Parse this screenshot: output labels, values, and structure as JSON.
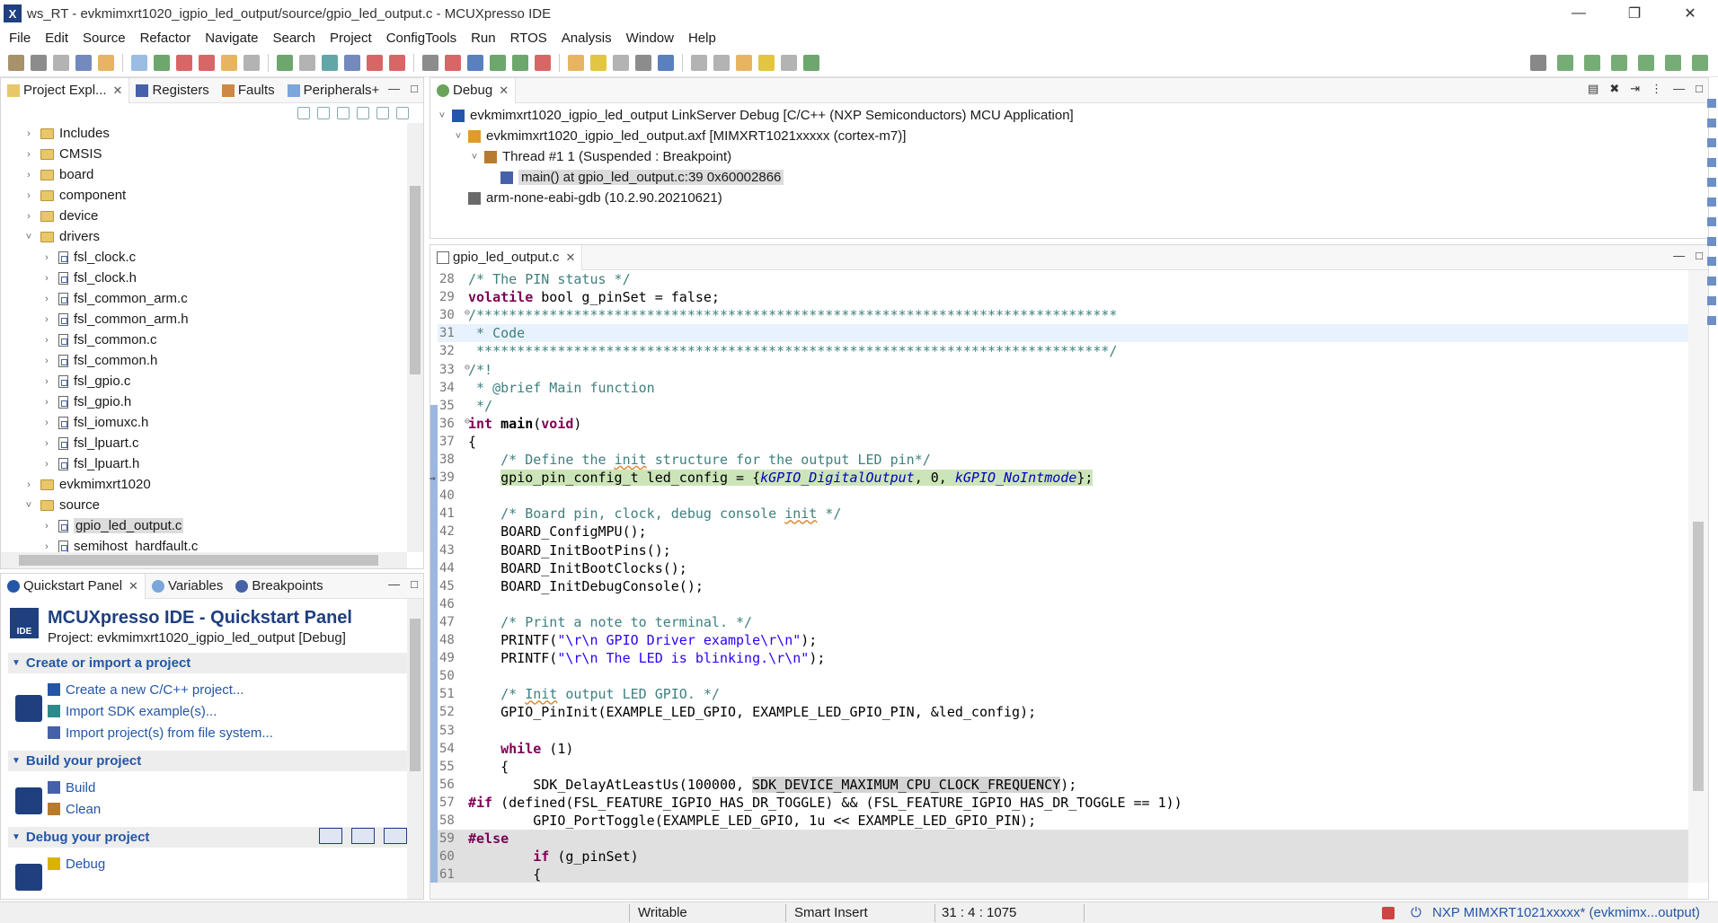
{
  "window": {
    "title": "ws_RT - evkmimxrt1020_igpio_led_output/source/gpio_led_output.c - MCUXpresso IDE",
    "logo_text": "X"
  },
  "menu": [
    "File",
    "Edit",
    "Source",
    "Refactor",
    "Navigate",
    "Search",
    "Project",
    "ConfigTools",
    "Run",
    "RTOS",
    "Analysis",
    "Window",
    "Help"
  ],
  "project_panel": {
    "tabs": [
      {
        "label": "Project Expl...",
        "icon": "project-explorer-icon"
      },
      {
        "label": "Registers",
        "icon": "registers-icon"
      },
      {
        "label": "Faults",
        "icon": "faults-icon"
      },
      {
        "label": "Peripherals+",
        "icon": "peripherals-icon"
      }
    ],
    "tree": [
      {
        "label": "Includes",
        "type": "folder",
        "depth": 1,
        "expanded": false
      },
      {
        "label": "CMSIS",
        "type": "folder",
        "depth": 1,
        "expanded": false
      },
      {
        "label": "board",
        "type": "folder",
        "depth": 1,
        "expanded": false
      },
      {
        "label": "component",
        "type": "folder",
        "depth": 1,
        "expanded": false
      },
      {
        "label": "device",
        "type": "folder",
        "depth": 1,
        "expanded": false
      },
      {
        "label": "drivers",
        "type": "folder",
        "depth": 1,
        "expanded": true
      },
      {
        "label": "fsl_clock.c",
        "type": "file",
        "depth": 2
      },
      {
        "label": "fsl_clock.h",
        "type": "file",
        "depth": 2
      },
      {
        "label": "fsl_common_arm.c",
        "type": "file",
        "depth": 2
      },
      {
        "label": "fsl_common_arm.h",
        "type": "file",
        "depth": 2
      },
      {
        "label": "fsl_common.c",
        "type": "file",
        "depth": 2
      },
      {
        "label": "fsl_common.h",
        "type": "file",
        "depth": 2
      },
      {
        "label": "fsl_gpio.c",
        "type": "file",
        "depth": 2
      },
      {
        "label": "fsl_gpio.h",
        "type": "file",
        "depth": 2
      },
      {
        "label": "fsl_iomuxc.h",
        "type": "file",
        "depth": 2
      },
      {
        "label": "fsl_lpuart.c",
        "type": "file",
        "depth": 2
      },
      {
        "label": "fsl_lpuart.h",
        "type": "file",
        "depth": 2
      },
      {
        "label": "evkmimxrt1020",
        "type": "folder",
        "depth": 1,
        "expanded": false
      },
      {
        "label": "source",
        "type": "folder",
        "depth": 1,
        "expanded": true
      },
      {
        "label": "gpio_led_output.c",
        "type": "file",
        "depth": 2,
        "selected": true
      },
      {
        "label": "semihost_hardfault.c",
        "type": "file",
        "depth": 2
      }
    ]
  },
  "quickstart_panel": {
    "tabs": [
      {
        "label": "Quickstart Panel",
        "icon": "quickstart-icon"
      },
      {
        "label": "Variables",
        "icon": "variables-icon"
      },
      {
        "label": "Breakpoints",
        "icon": "breakpoints-icon"
      }
    ],
    "title": "MCUXpresso IDE - Quickstart Panel",
    "project_line": "Project: evkmimxrt1020_igpio_led_output [Debug]",
    "logo_text": "IDE",
    "sections": [
      {
        "title": "Create or import a project",
        "links": [
          "Create a new C/C++ project...",
          "Import SDK example(s)...",
          "Import project(s) from file system..."
        ]
      },
      {
        "title": "Build your project",
        "links": [
          "Build",
          "Clean"
        ]
      },
      {
        "title": "Debug your project",
        "links": [
          "Debug"
        ]
      }
    ]
  },
  "debug_panel": {
    "tab": "Debug",
    "rows": [
      {
        "label": "evkmimxrt1020_igpio_led_output LinkServer Debug [C/C++ (NXP Semiconductors) MCU Application]",
        "depth": 0
      },
      {
        "label": "evkmimxrt1020_igpio_led_output.axf [MIMXRT1021xxxxx (cortex-m7)]",
        "depth": 1
      },
      {
        "label": "Thread #1 1 (Suspended : Breakpoint)",
        "depth": 2
      },
      {
        "label": "main() at gpio_led_output.c:39 0x60002866",
        "depth": 3,
        "selected": true
      },
      {
        "label": "arm-none-eabi-gdb (10.2.90.20210621)",
        "depth": 1
      }
    ]
  },
  "editor": {
    "tab": "gpio_led_output.c",
    "lines": [
      {
        "n": "28",
        "html": "<span class=\"c\">/* The PIN status */</span>"
      },
      {
        "n": "29",
        "html": "<span class=\"k\">volatile</span> bool g_pinSet = false;"
      },
      {
        "n": "30",
        "fold": true,
        "html": "<span class=\"c\">/*******************************************************************************</span>"
      },
      {
        "n": "31",
        "cur": true,
        "html": "<span class=\"c\"> * Code</span>"
      },
      {
        "n": "32",
        "html": "<span class=\"c\"> ******************************************************************************/</span>"
      },
      {
        "n": "33",
        "fold": true,
        "html": "<span class=\"c\">/*!</span>"
      },
      {
        "n": "34",
        "html": "<span class=\"c\"> * @brief Main function</span>"
      },
      {
        "n": "35",
        "html": "<span class=\"c\"> */</span>"
      },
      {
        "n": "36",
        "fold": true,
        "html": "<span class=\"k\">int</span> <span class=\"f\">main</span>(<span class=\"k\">void</span>)"
      },
      {
        "n": "37",
        "html": "{"
      },
      {
        "n": "38",
        "html": "    <span class=\"c\">/* Define the <span class=\"sq\">init</span> structure for the output LED pin*/</span>"
      },
      {
        "n": "39",
        "exec": true,
        "html": "    <span class=\"hl-exec\">gpio_pin_config_t led_config = {<span class=\"i\">kGPIO_DigitalOutput</span>, 0, <span class=\"i\">kGPIO_NoIntmode</span>};</span>"
      },
      {
        "n": "40",
        "html": ""
      },
      {
        "n": "41",
        "html": "    <span class=\"c\">/* Board pin, clock, debug console <span class=\"sq\">init</span> */</span>"
      },
      {
        "n": "42",
        "html": "    BOARD_ConfigMPU();"
      },
      {
        "n": "43",
        "html": "    BOARD_InitBootPins();"
      },
      {
        "n": "44",
        "html": "    BOARD_InitBootClocks();"
      },
      {
        "n": "45",
        "html": "    BOARD_InitDebugConsole();"
      },
      {
        "n": "46",
        "html": ""
      },
      {
        "n": "47",
        "html": "    <span class=\"c\">/* Print a note to terminal. */</span>"
      },
      {
        "n": "48",
        "html": "    PRINTF(<span class=\"s\">\"\\r\\n GPIO Driver example\\r\\n\"</span>);"
      },
      {
        "n": "49",
        "html": "    PRINTF(<span class=\"s\">\"\\r\\n The LED is blinking.\\r\\n\"</span>);"
      },
      {
        "n": "50",
        "html": ""
      },
      {
        "n": "51",
        "html": "    <span class=\"c\">/* <span class=\"sq\">Init</span> output LED GPIO. */</span>"
      },
      {
        "n": "52",
        "html": "    GPIO_PinInit(EXAMPLE_LED_GPIO, EXAMPLE_LED_GPIO_PIN, &amp;led_config);"
      },
      {
        "n": "53",
        "html": ""
      },
      {
        "n": "54",
        "html": "    <span class=\"k\">while</span> (1)"
      },
      {
        "n": "55",
        "html": "    {"
      },
      {
        "n": "56",
        "html": "        SDK_DelayAtLeastUs(100000, <span class=\"occ\">SDK_DEVICE_MAXIMUM_CPU_CLOCK_FREQUENCY</span>);"
      },
      {
        "n": "57",
        "html": "<span class=\"k\">#if</span> (defined(FSL_FEATURE_IGPIO_HAS_DR_TOGGLE) &amp;&amp; (FSL_FEATURE_IGPIO_HAS_DR_TOGGLE == 1))"
      },
      {
        "n": "58",
        "html": "        GPIO_PortToggle(EXAMPLE_LED_GPIO, 1u &lt;&lt; EXAMPLE_LED_GPIO_PIN);"
      },
      {
        "n": "59",
        "inactive": true,
        "html": "<span class=\"k\">#else</span>"
      },
      {
        "n": "60",
        "inactive": true,
        "html": "        <span class=\"k\">if</span> (g_pinSet)"
      },
      {
        "n": "61",
        "inactive": true,
        "html": "        {"
      }
    ]
  },
  "status": {
    "writable": "Writable",
    "insert_mode": "Smart Insert",
    "position": "31 : 4 : 1075",
    "target": "NXP MIMXRT1021xxxxx* (evkmimx...output)"
  }
}
